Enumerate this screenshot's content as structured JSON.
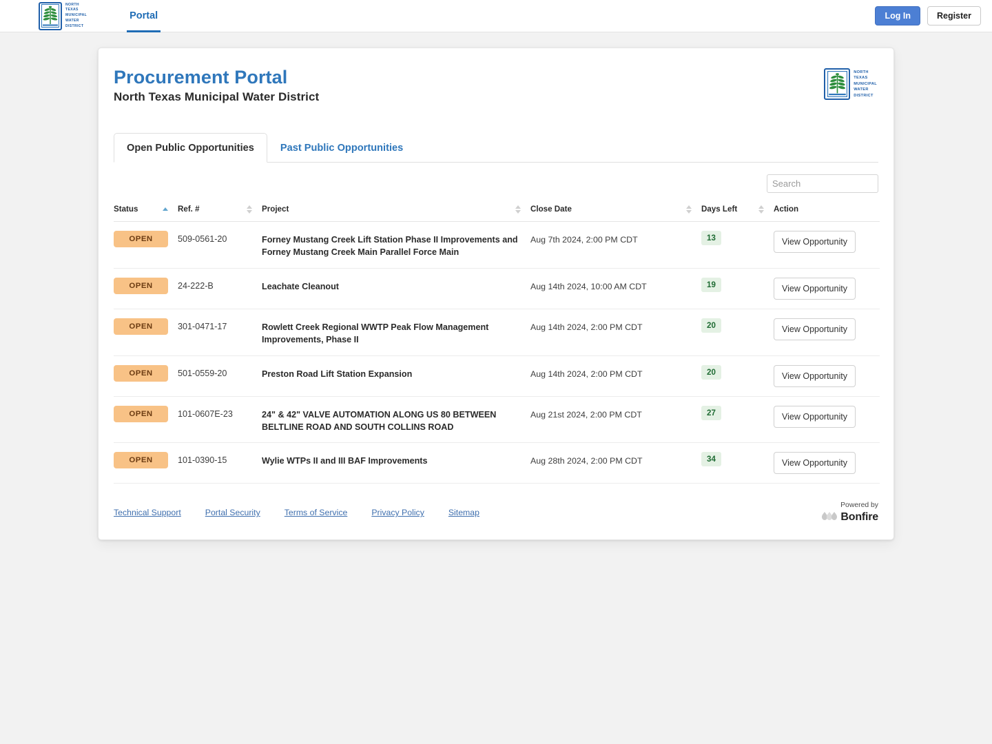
{
  "nav": {
    "brand": {
      "icon": "ntmwd-plant-logo",
      "words": [
        "NORTH",
        "TEXAS",
        "MUNICIPAL",
        "WATER",
        "DISTRICT"
      ]
    },
    "links": [
      {
        "label": "Portal",
        "active": true
      }
    ],
    "login_label": "Log In",
    "register_label": "Register"
  },
  "header": {
    "title": "Procurement Portal",
    "subtitle": "North Texas Municipal Water District",
    "logo_words": [
      "NORTH",
      "TEXAS",
      "MUNICIPAL",
      "WATER",
      "DISTRICT"
    ]
  },
  "tabs": [
    {
      "label": "Open Public Opportunities",
      "active": true
    },
    {
      "label": "Past Public Opportunities",
      "active": false
    }
  ],
  "search": {
    "placeholder": "Search",
    "value": ""
  },
  "table": {
    "columns": [
      {
        "label": "Status",
        "sort": "asc"
      },
      {
        "label": "Ref. #",
        "sort": "none"
      },
      {
        "label": "Project",
        "sort": "none"
      },
      {
        "label": "Close Date",
        "sort": "none"
      },
      {
        "label": "Days Left",
        "sort": "none"
      },
      {
        "label": "Action",
        "sort": "none"
      }
    ],
    "action_label": "View Opportunity",
    "rows": [
      {
        "status": "OPEN",
        "ref": "509-0561-20",
        "project": "Forney Mustang Creek Lift Station Phase II Improvements and Forney Mustang Creek Main Parallel Force Main",
        "close_date": "Aug 7th 2024, 2:00 PM CDT",
        "days_left": "13"
      },
      {
        "status": "OPEN",
        "ref": "24-222-B",
        "project": "Leachate Cleanout",
        "close_date": "Aug 14th 2024, 10:00 AM CDT",
        "days_left": "19"
      },
      {
        "status": "OPEN",
        "ref": "301-0471-17",
        "project": "Rowlett Creek Regional WWTP Peak Flow Management Improvements, Phase II",
        "close_date": "Aug 14th 2024, 2:00 PM CDT",
        "days_left": "20"
      },
      {
        "status": "OPEN",
        "ref": "501-0559-20",
        "project": "Preston Road Lift Station Expansion",
        "close_date": "Aug 14th 2024, 2:00 PM CDT",
        "days_left": "20"
      },
      {
        "status": "OPEN",
        "ref": "101-0607E-23",
        "project": "24\" & 42\" VALVE AUTOMATION ALONG US 80 BETWEEN BELTLINE ROAD AND SOUTH COLLINS ROAD",
        "close_date": "Aug 21st 2024, 2:00 PM CDT",
        "days_left": "27"
      },
      {
        "status": "OPEN",
        "ref": "101-0390-15",
        "project": "Wylie WTPs II and III BAF Improvements",
        "close_date": "Aug 28th 2024, 2:00 PM CDT",
        "days_left": "34"
      }
    ]
  },
  "footer": {
    "links": [
      "Technical Support",
      "Portal Security",
      "Terms of Service",
      "Privacy Policy",
      "Sitemap"
    ],
    "powered_by_label": "Powered by",
    "powered_by_brand": "Bonfire"
  },
  "colors": {
    "brand_blue": "#2f77bb",
    "nav_blue": "#1f6cb5",
    "login_button": "#4c7fd4",
    "status_badge_bg": "#f8c286",
    "status_badge_text": "#6b3b12",
    "days_badge_bg": "#e4f1e4",
    "days_badge_text": "#1f6b33",
    "page_bg": "#f2f2f2"
  }
}
